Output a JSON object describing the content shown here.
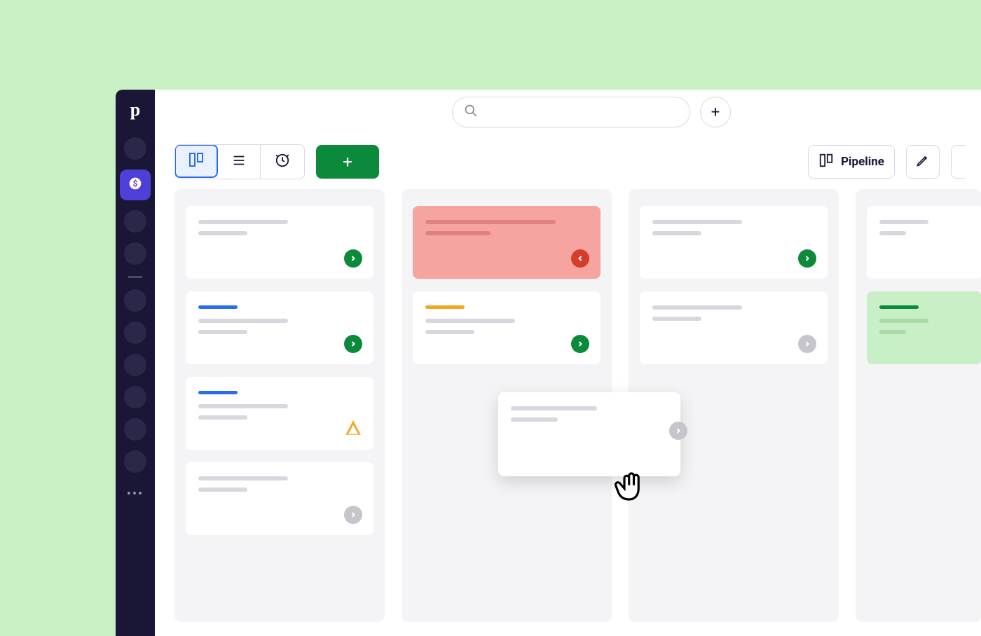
{
  "app": {
    "logo_text": "p"
  },
  "sidebar": {
    "items": [
      {
        "name": "nav-item-1",
        "active": false
      },
      {
        "name": "nav-item-deals",
        "active": true,
        "icon": "dollar"
      },
      {
        "name": "nav-item-3",
        "active": false
      },
      {
        "name": "nav-item-4",
        "active": false
      }
    ],
    "items_after": [
      {
        "name": "nav-item-5"
      },
      {
        "name": "nav-item-6"
      },
      {
        "name": "nav-item-7"
      },
      {
        "name": "nav-item-8"
      },
      {
        "name": "nav-item-9"
      },
      {
        "name": "nav-item-10"
      }
    ],
    "more_label": "•••"
  },
  "topbar": {
    "search_placeholder": "",
    "add_label": "+"
  },
  "toolbar": {
    "view_modes": [
      "board",
      "list",
      "forecast"
    ],
    "active_view": "board",
    "add_deal_label": "+",
    "pipeline_label": "Pipeline"
  },
  "columns": [
    {
      "name": "stage-1",
      "cards": [
        {
          "tag": null,
          "lines": [
            "w55",
            "w30"
          ],
          "badge": "green"
        },
        {
          "tag": "blue",
          "lines": [
            "w55",
            "w30"
          ],
          "badge": "green"
        },
        {
          "tag": "blue",
          "lines": [
            "w55",
            "w30"
          ],
          "badge": "warn"
        },
        {
          "tag": null,
          "lines": [
            "w55",
            "w30"
          ],
          "badge": "gray"
        }
      ]
    },
    {
      "name": "stage-2",
      "cards": [
        {
          "tag": null,
          "variant": "alert",
          "lines": [
            "w80",
            "w40"
          ],
          "badge": "red"
        },
        {
          "tag": "orange",
          "lines": [
            "w55",
            "w30"
          ],
          "badge": "green"
        }
      ]
    },
    {
      "name": "stage-3",
      "cards": [
        {
          "tag": null,
          "lines": [
            "w55",
            "w30"
          ],
          "badge": "green"
        },
        {
          "tag": null,
          "lines": [
            "w55",
            "w30"
          ],
          "badge": "gray"
        }
      ]
    },
    {
      "name": "stage-4",
      "cards": [
        {
          "tag": null,
          "lines": [
            "w55",
            "w30"
          ]
        },
        {
          "tag": "green",
          "variant": "positive",
          "lines": [
            "w55",
            "w30"
          ]
        }
      ]
    }
  ],
  "drag_card": {
    "lines": [
      "w55",
      "w30"
    ],
    "badge": "gray"
  }
}
